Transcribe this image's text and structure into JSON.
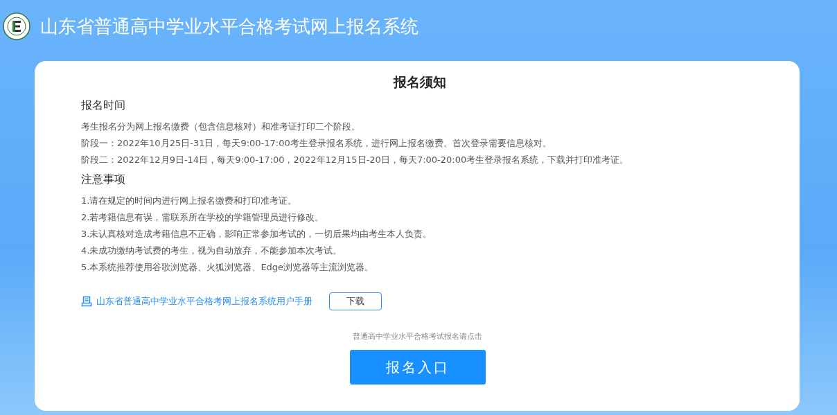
{
  "header": {
    "title": "山东省普通高中学业水平合格考试网上报名系统"
  },
  "notice": {
    "title": "报名须知",
    "sections": [
      {
        "heading": "报名时间",
        "lines": [
          "考生报名分为网上报名缴费（包含信息核对）和准考证打印二个阶段。",
          "阶段一：2022年10月25日-31日，每天9:00-17:00考生登录报名系统，进行网上报名缴费。首次登录需要信息核对。",
          "阶段二：2022年12月9日-14日，每天9:00-17:00，2022年12月15日-20日，每天7:00-20:00考生登录报名系统，下载并打印准考证。"
        ]
      },
      {
        "heading": "注意事项",
        "lines": [
          "1.请在规定的时间内进行网上报名缴费和打印准考证。",
          "2.若考籍信息有误，需联系所在学校的学籍管理员进行修改。",
          "3.未认真核对造成考籍信息不正确，影响正常参加考试的，一切后果均由考生本人负责。",
          "4.未成功缴纳考试费的考生，视为自动放弃，不能参加本次考试。",
          "5.本系统推荐使用谷歌浏览器、火狐浏览器、Edge浏览器等主流浏览器。"
        ]
      }
    ],
    "manual": {
      "link": "山东省普通高中学业水平合格考网上报名系统用户手册",
      "button": "下载"
    },
    "hint": "普通高中学业水平合格考试报名请点击",
    "entry_button": "报名入口"
  }
}
